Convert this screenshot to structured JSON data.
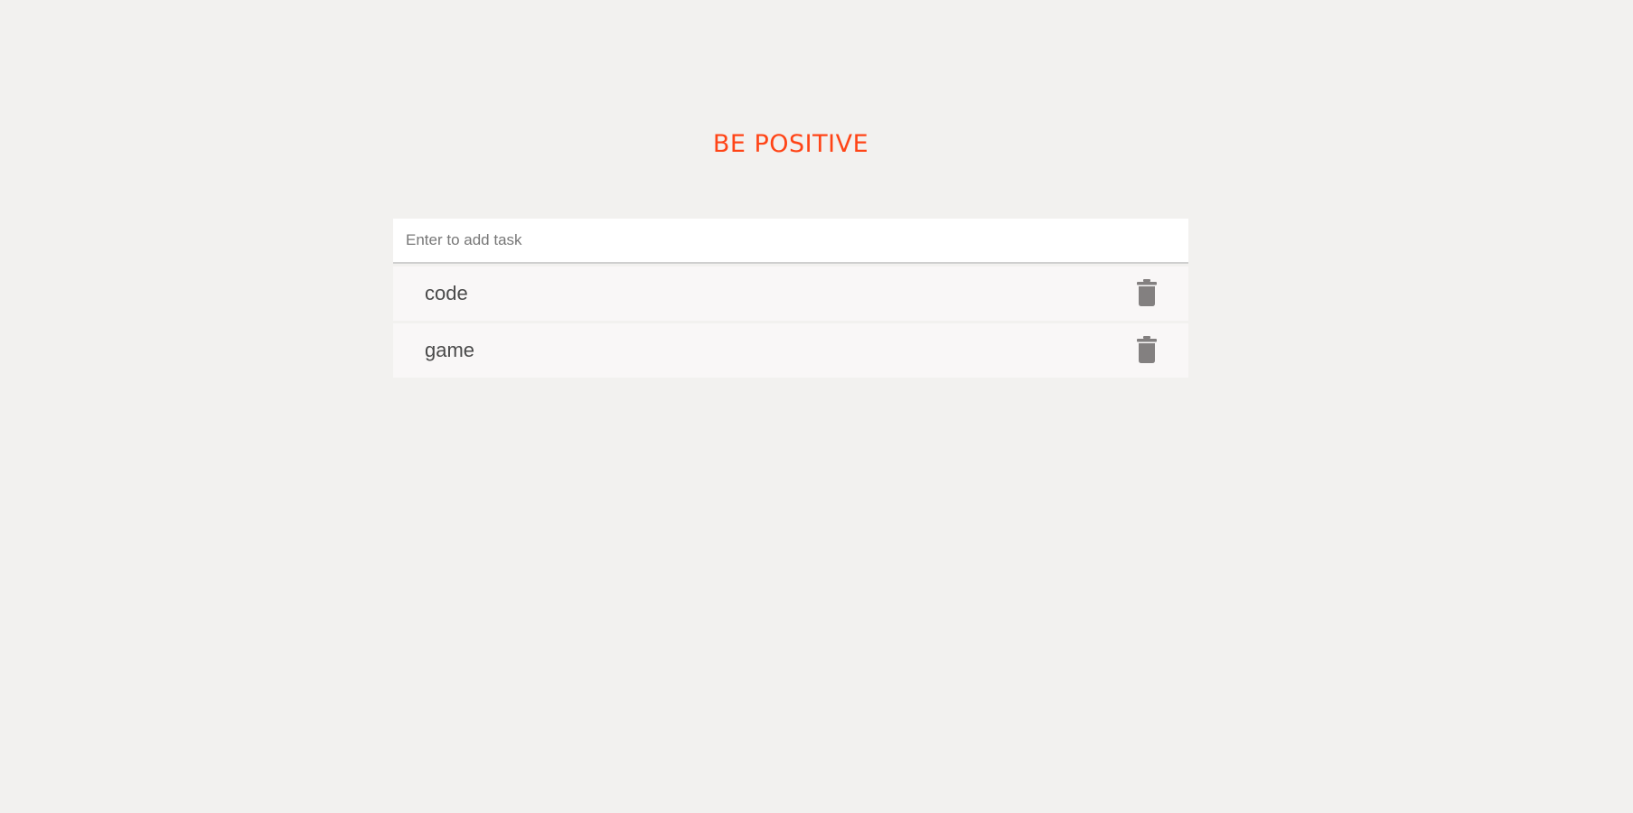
{
  "header": {
    "title": "BE POSITIVE"
  },
  "task_input": {
    "placeholder": "Enter to add task",
    "value": ""
  },
  "tasks": [
    {
      "text": "code",
      "delete_icon": "trash-icon"
    },
    {
      "text": "game",
      "delete_icon": "trash-icon"
    }
  ],
  "colors": {
    "background": "#f2f1ef",
    "title": "#ff4416",
    "input_background": "#ffffff",
    "item_background": "#f9f7f7",
    "item_text": "#4a4a4a",
    "icon": "#838080"
  }
}
